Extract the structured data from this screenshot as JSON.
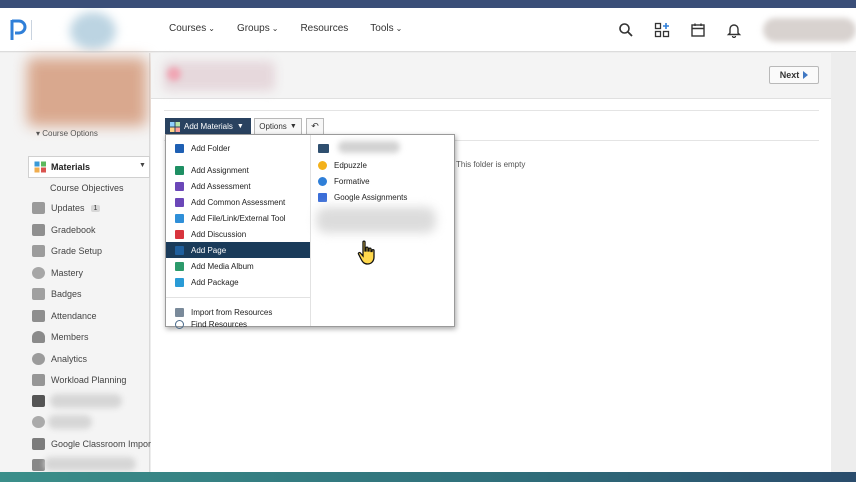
{
  "topbar": {
    "nav": [
      {
        "label": "Courses",
        "has_caret": true
      },
      {
        "label": "Groups",
        "has_caret": true
      },
      {
        "label": "Resources",
        "has_caret": false
      },
      {
        "label": "Tools",
        "has_caret": true
      }
    ],
    "icons": [
      "search-icon",
      "apps-grid-icon",
      "calendar-icon",
      "notifications-bell-icon"
    ]
  },
  "sidebar": {
    "course_options_label": "Course Options",
    "active_item": "Materials",
    "sub_item": "Course Objectives",
    "items": [
      {
        "label": "Updates",
        "badge": "1"
      },
      {
        "label": "Gradebook"
      },
      {
        "label": "Grade Setup"
      },
      {
        "label": "Mastery"
      },
      {
        "label": "Badges"
      },
      {
        "label": "Attendance"
      },
      {
        "label": "Members"
      },
      {
        "label": "Analytics"
      },
      {
        "label": "Workload Planning"
      },
      {
        "label": "Google Classroom Import"
      }
    ]
  },
  "header": {
    "next_label": "Next"
  },
  "toolbar": {
    "add_materials_label": "Add Materials",
    "options_label": "Options",
    "undo_icon": "undo-arrow-icon"
  },
  "folder": {
    "empty_message": "This folder is empty"
  },
  "add_menu": {
    "left_items": [
      {
        "label": "Add Folder",
        "color": "#1e5fb3"
      },
      {
        "label": "Add Assignment",
        "color": "#1e8f63"
      },
      {
        "label": "Add Assessment",
        "color": "#6b47b8"
      },
      {
        "label": "Add Common Assessment",
        "color": "#6b47b8"
      },
      {
        "label": "Add File/Link/External Tool",
        "color": "#2f8fd8"
      },
      {
        "label": "Add Discussion",
        "color": "#d8343d"
      },
      {
        "label": "Add Page",
        "color": "#1f5f9e",
        "active": true
      },
      {
        "label": "Add Media Album",
        "color": "#2c9a6b"
      },
      {
        "label": "Add Package",
        "color": "#2a9bd6"
      }
    ],
    "bottom_items": [
      {
        "label": "Import from Resources",
        "color": "#7a8a9a"
      },
      {
        "label": "Find Resources",
        "color": "#4a6a8a"
      }
    ],
    "right_items": [
      {
        "label": "Edpuzzle",
        "color": "#f3b11b"
      },
      {
        "label": "Formative",
        "color": "#2f7fd8"
      },
      {
        "label": "Google Assignments",
        "color": "#3b6ed8"
      }
    ],
    "active_label": "Add Page"
  },
  "colors": {
    "accent_dark": "#294260",
    "menu_highlight": "#1a3b5a",
    "brand_blue": "#2f7fd8"
  }
}
